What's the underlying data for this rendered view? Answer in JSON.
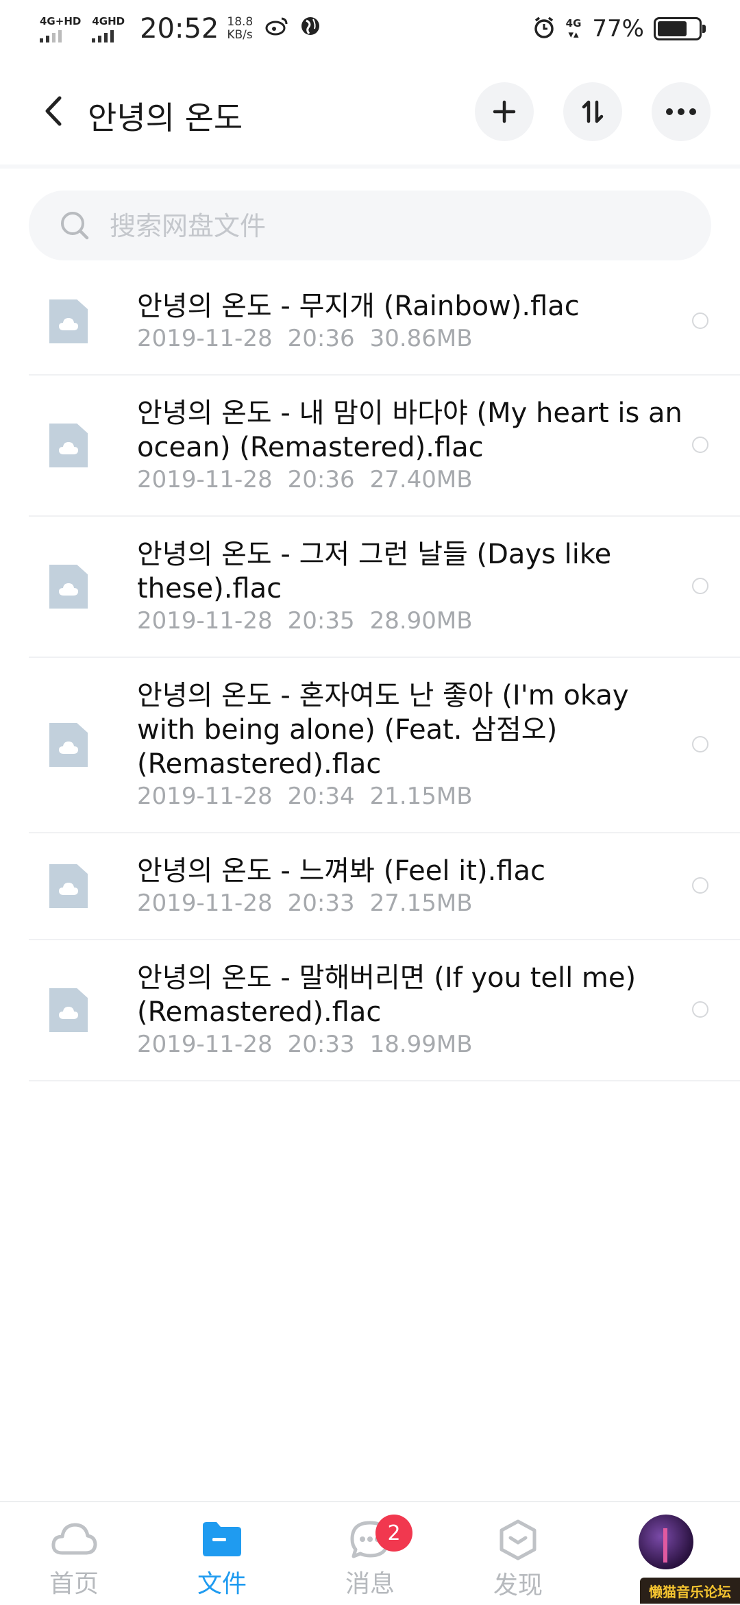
{
  "status_bar": {
    "network1": "4G+HD",
    "network2": "4GHD",
    "time": "20:52",
    "speed_value": "18.8",
    "speed_unit": "KB/s",
    "network3": "4G",
    "battery": "77%",
    "battery_level": 0.77
  },
  "header": {
    "title": "안녕의 온도",
    "icons": [
      "back-arrow-icon",
      "plus-icon",
      "sort-icon",
      "more-icon"
    ]
  },
  "search": {
    "placeholder": "搜索网盘文件"
  },
  "files": [
    {
      "name": "안녕의 온도 - 무지개 (Rainbow).flac",
      "date": "2019-11-28",
      "time": "20:36",
      "size": "30.86MB"
    },
    {
      "name": "안녕의 온도 - 내 맘이 바다야 (My heart is an ocean) (Remastered).flac",
      "date": "2019-11-28",
      "time": "20:36",
      "size": "27.40MB"
    },
    {
      "name": "안녕의 온도 - 그저 그런 날들 (Days like these).flac",
      "date": "2019-11-28",
      "time": "20:35",
      "size": "28.90MB"
    },
    {
      "name": "안녕의 온도 - 혼자여도 난 좋아 (I'm okay with being alone) (Feat. 삼점오) (Remastered).flac",
      "date": "2019-11-28",
      "time": "20:34",
      "size": "21.15MB"
    },
    {
      "name": "안녕의 온도 - 느껴봐 (Feel it).flac",
      "date": "2019-11-28",
      "time": "20:33",
      "size": "27.15MB"
    },
    {
      "name": "안녕의 온도 - 말해버리면 (If you tell me) (Remastered).flac",
      "date": "2019-11-28",
      "time": "20:33",
      "size": "18.99MB"
    }
  ],
  "tabs": [
    {
      "label": "首页",
      "icon": "cloud-icon",
      "active": false
    },
    {
      "label": "文件",
      "icon": "folder-icon",
      "active": true
    },
    {
      "label": "消息",
      "icon": "chat-icon",
      "active": false,
      "badge": "2"
    },
    {
      "label": "发现",
      "icon": "discover-icon",
      "active": false
    }
  ],
  "watermark": "懒猫音乐论坛",
  "colors": {
    "accent": "#1f9bf0",
    "badge": "#f1384f",
    "file_icon": "#c2d0dc",
    "meta_text": "#a6a9ad"
  }
}
